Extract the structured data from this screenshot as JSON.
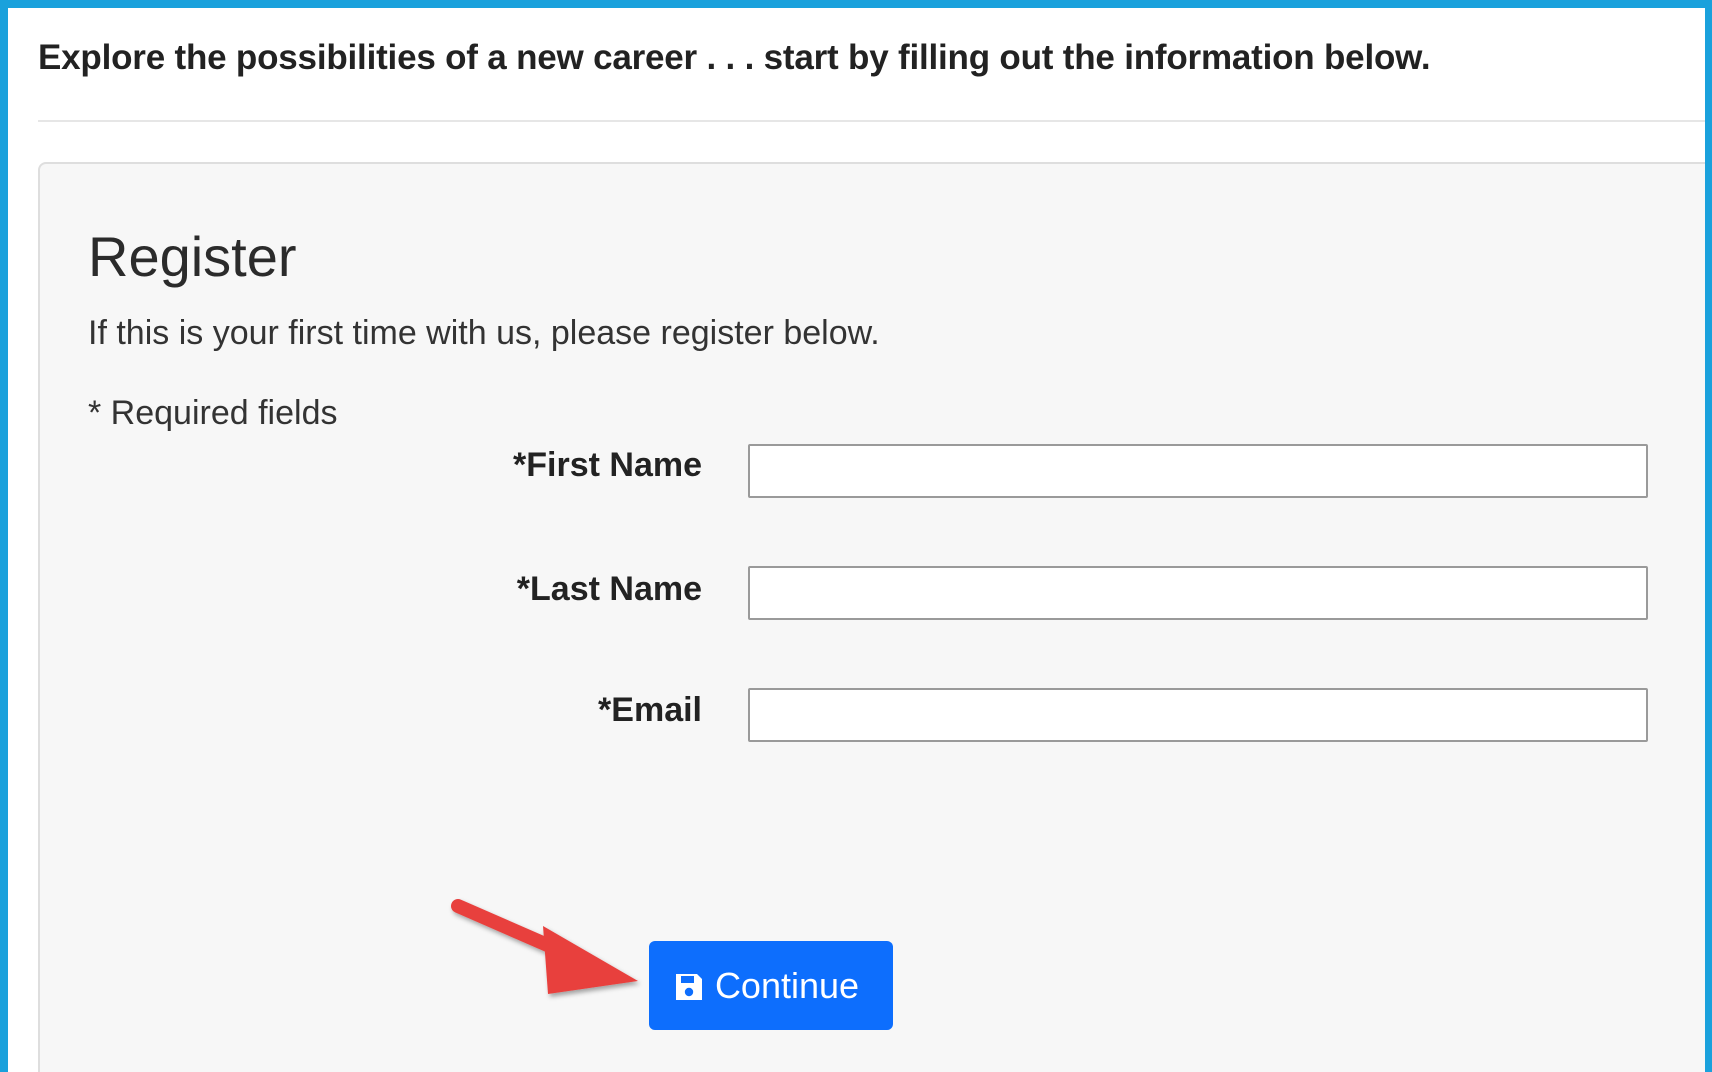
{
  "header": {
    "intro_text": "Explore the possibilities of a new career . . . start by filling out the information below."
  },
  "register": {
    "title": "Register",
    "subtitle": "If this is your first time with us, please register below.",
    "required_note": "* Required fields",
    "fields": [
      {
        "label": "*First Name",
        "value": "",
        "placeholder": ""
      },
      {
        "label": "*Last Name",
        "value": "",
        "placeholder": ""
      },
      {
        "label": "*Email",
        "value": "",
        "placeholder": ""
      }
    ],
    "continue_label": "Continue",
    "continue_icon": "floppy-disk-save-icon"
  },
  "colors": {
    "frame_border": "#1aa1dc",
    "button_primary": "#0d6efd",
    "annotation_arrow": "#e8413e",
    "panel_background": "#f7f7f7"
  },
  "annotation": {
    "arrow_icon": "red-pointer-arrow"
  }
}
